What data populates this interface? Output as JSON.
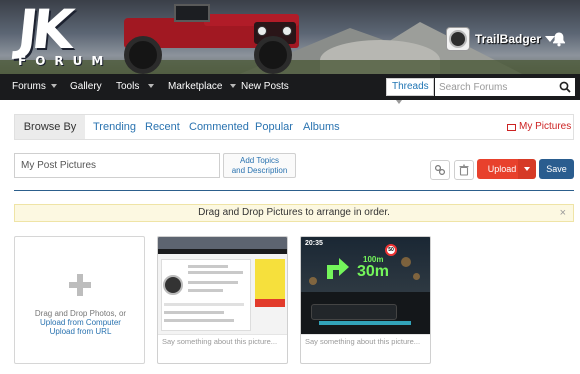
{
  "header": {
    "logo_text": "JK",
    "logo_subtext": "FORUM",
    "username": "TrailBadger"
  },
  "nav": {
    "items": [
      {
        "label": "Forums",
        "has_dropdown": true
      },
      {
        "label": "Gallery",
        "has_dropdown": false
      },
      {
        "label": "Tools",
        "has_dropdown": true
      },
      {
        "label": "Marketplace",
        "has_dropdown": true
      },
      {
        "label": "New Posts",
        "has_dropdown": false
      }
    ],
    "search_scope": "Threads",
    "search_placeholder": "Search Forums"
  },
  "browse": {
    "label": "Browse By",
    "tabs": [
      "Trending",
      "Recent",
      "Commented",
      "Popular",
      "Albums"
    ],
    "my_pictures": "My Pictures"
  },
  "album": {
    "name_placeholder": "My Post Pictures",
    "add_topics_line1": "Add Topics",
    "add_topics_line2": "and Description",
    "upload_label": "Upload",
    "save_label": "Save"
  },
  "notice": {
    "text": "Drag and Drop Pictures to arrange in order.",
    "close": "×"
  },
  "uploader": {
    "line1": "Drag and Drop Photos, or",
    "line2": "Upload from Computer",
    "line3": "Upload from URL"
  },
  "photos": [
    {
      "caption_placeholder": "Say something about this picture..."
    },
    {
      "caption_placeholder": "Say something about this picture...",
      "hud_time": "20:35",
      "hud_speed": "50",
      "hud_distance_small": "100",
      "hud_distance_small_unit": "m",
      "hud_distance": "30",
      "hud_distance_unit": "m"
    }
  ],
  "colors": {
    "nav_bg": "#1a1b1d",
    "link_blue": "#2a73b0",
    "upload_red": "#e8412c",
    "save_blue": "#2a5d8f",
    "notice_bg": "#fcf8e1",
    "my_pictures_red": "#cc2222"
  }
}
